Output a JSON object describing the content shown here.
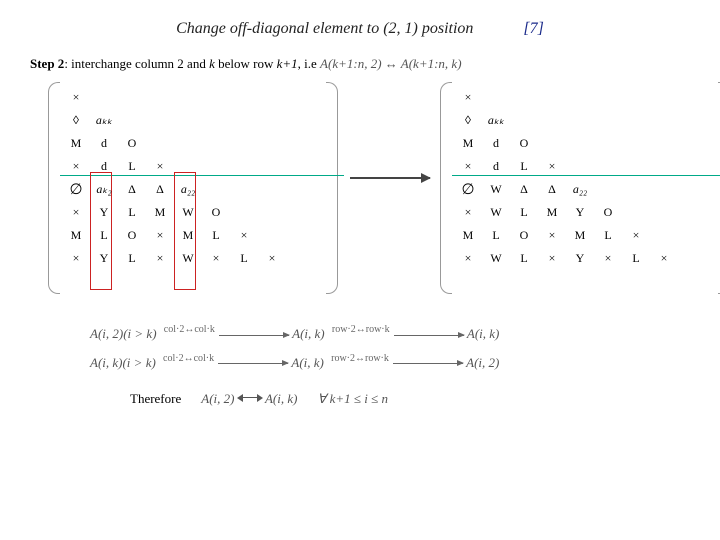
{
  "header": {
    "title": "Change off-diagonal element to (2, 1) position",
    "page_marker": "[7]"
  },
  "step": {
    "label": "Step 2",
    "text_a": ": interchange column 2 and ",
    "var_k": "k",
    "text_b": " below row ",
    "var_kp1": "k+1",
    "text_c": ", i.e ",
    "expr": "A(k+1:n, 2) ↔ A(k+1:n, k)"
  },
  "matrix_left": {
    "rows": [
      [
        "×",
        "",
        "",
        "",
        "",
        "",
        "",
        "",
        "",
        ""
      ],
      [
        "◊",
        "aₖₖ",
        "",
        "",
        "",
        "",
        "",
        "",
        "",
        ""
      ],
      [
        "M",
        "d",
        "O",
        "",
        "",
        "",
        "",
        "",
        "",
        ""
      ],
      [
        "×",
        "d",
        "L",
        "×",
        "",
        "",
        "",
        "",
        "",
        ""
      ],
      [
        "∅",
        "aₖ₂",
        "Δ",
        "Δ",
        "a₂₂",
        "",
        "",
        "",
        "",
        ""
      ],
      [
        "×",
        "Y",
        "L",
        "M",
        "W",
        "O",
        "",
        "",
        "",
        ""
      ],
      [
        "M",
        "L",
        "O",
        "×",
        "M",
        "L",
        "×",
        "",
        "",
        ""
      ],
      [
        "×",
        "Y",
        "L",
        "×",
        "W",
        "×",
        "L",
        "×",
        "",
        ""
      ]
    ]
  },
  "matrix_right": {
    "rows": [
      [
        "×",
        "",
        "",
        "",
        "",
        "",
        "",
        "",
        "",
        ""
      ],
      [
        "◊",
        "aₖₖ",
        "",
        "",
        "",
        "",
        "",
        "",
        "",
        ""
      ],
      [
        "M",
        "d",
        "O",
        "",
        "",
        "",
        "",
        "",
        "",
        ""
      ],
      [
        "×",
        "d",
        "L",
        "×",
        "",
        "",
        "",
        "",
        "",
        ""
      ],
      [
        "∅",
        "W",
        "Δ",
        "Δ",
        "a₂₂",
        "",
        "",
        "",
        "",
        ""
      ],
      [
        "×",
        "W",
        "L",
        "M",
        "Y",
        "O",
        "",
        "",
        "",
        ""
      ],
      [
        "M",
        "L",
        "O",
        "×",
        "M",
        "L",
        "×",
        "",
        "",
        ""
      ],
      [
        "×",
        "W",
        "L",
        "×",
        "Y",
        "×",
        "L",
        "×",
        "",
        ""
      ]
    ]
  },
  "equations": {
    "line1_a": "A(i, 2)(i > k)",
    "line1_step1": "col·2↔col·k",
    "line1_b": "A(i, k)",
    "line1_step2": "row·2↔row·k",
    "line1_c": "A(i, k)",
    "line2_a": "A(i, k)(i > k)",
    "line2_step1": "col·2↔col·k",
    "line2_b": "A(i, k)",
    "line2_step2": "row·2↔row·k",
    "line2_c": "A(i, 2)"
  },
  "therefore": {
    "label": "Therefore",
    "lhs": "A(i, 2)",
    "rhs": "A(i, k)",
    "cond": "∀  k+1 ≤ i ≤ n"
  }
}
